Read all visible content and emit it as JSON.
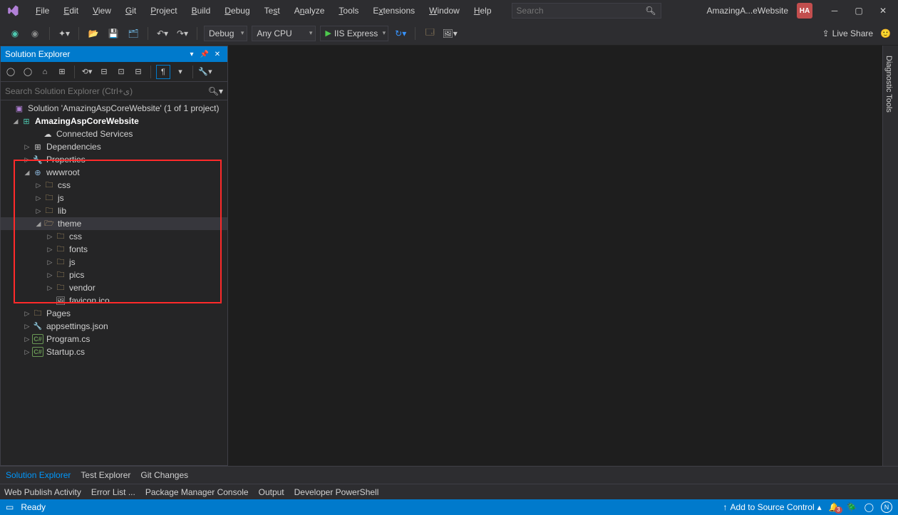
{
  "menu": [
    "File",
    "Edit",
    "View",
    "Git",
    "Project",
    "Build",
    "Debug",
    "Test",
    "Analyze",
    "Tools",
    "Extensions",
    "Window",
    "Help"
  ],
  "search_placeholder": "Search",
  "project_short": "AmazingA...eWebsite",
  "user_initials": "HA",
  "toolbar": {
    "config": "Debug",
    "platform": "Any CPU",
    "run": "IIS Express"
  },
  "live_share": "Live Share",
  "diagnostic": "Diagnostic Tools",
  "panel": {
    "title": "Solution Explorer",
    "search_placeholder": "Search Solution Explorer (Ctrl+ی)"
  },
  "tree": {
    "solution": "Solution 'AmazingAspCoreWebsite' (1 of 1 project)",
    "project": "AmazingAspCoreWebsite",
    "connected": "Connected Services",
    "dependencies": "Dependencies",
    "properties": "Properties",
    "wwwroot": "wwwroot",
    "css": "css",
    "js": "js",
    "lib": "lib",
    "theme": "theme",
    "theme_css": "css",
    "theme_fonts": "fonts",
    "theme_js": "js",
    "theme_pics": "pics",
    "theme_vendor": "vendor",
    "favicon": "favicon.ico",
    "pages": "Pages",
    "appsettings": "appsettings.json",
    "program": "Program.cs",
    "startup": "Startup.cs"
  },
  "bottom_tabs": [
    "Solution Explorer",
    "Test Explorer",
    "Git Changes"
  ],
  "output_tabs": [
    "Web Publish Activity",
    "Error List ...",
    "Package Manager Console",
    "Output",
    "Developer PowerShell"
  ],
  "status": {
    "ready": "Ready",
    "source_control": "Add to Source Control",
    "notif_count": "3"
  }
}
